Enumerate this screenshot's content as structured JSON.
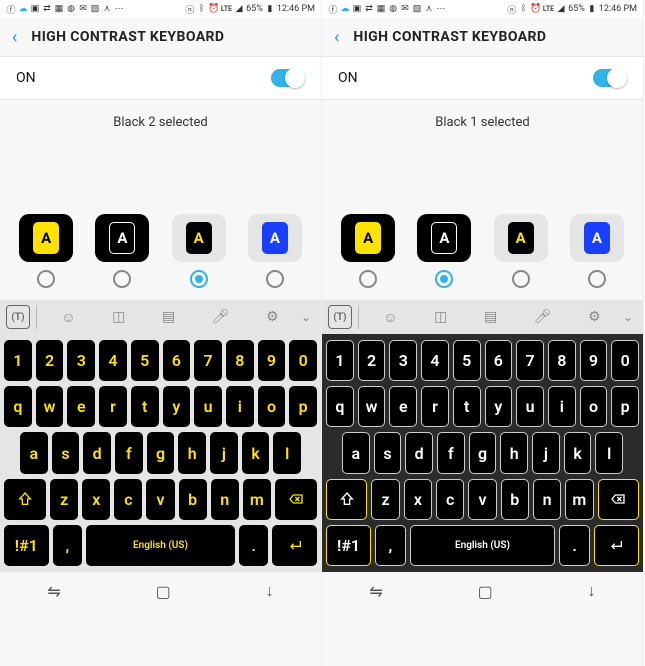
{
  "status": {
    "lte": "LTE",
    "battery": "65%",
    "time": "12:46 PM"
  },
  "header": {
    "title": "HIGH CONTRAST KEYBOARD"
  },
  "toggle": {
    "label": "ON"
  },
  "themes": {
    "letter": "A",
    "items": [
      {
        "id": "yellow1",
        "class": "t-yellow1"
      },
      {
        "id": "black1",
        "class": "t-black1"
      },
      {
        "id": "black2",
        "class": "t-black2"
      },
      {
        "id": "blue",
        "class": "t-blue"
      }
    ]
  },
  "keyboard": {
    "row_num": [
      "1",
      "2",
      "3",
      "4",
      "5",
      "6",
      "7",
      "8",
      "9",
      "0"
    ],
    "row_q": [
      "q",
      "w",
      "e",
      "r",
      "t",
      "y",
      "u",
      "i",
      "o",
      "p"
    ],
    "row_a": [
      "a",
      "s",
      "d",
      "f",
      "g",
      "h",
      "j",
      "k",
      "l"
    ],
    "row_z": [
      "z",
      "x",
      "c",
      "v",
      "b",
      "n",
      "m"
    ],
    "sym": "!#1",
    "comma": ",",
    "period": ".",
    "space": "English (US)"
  },
  "left": {
    "selected_text": "Black 2 selected",
    "selected_index": 2,
    "kb_theme": "black2"
  },
  "right": {
    "selected_text": "Black 1 selected",
    "selected_index": 1,
    "kb_theme": "black1"
  }
}
